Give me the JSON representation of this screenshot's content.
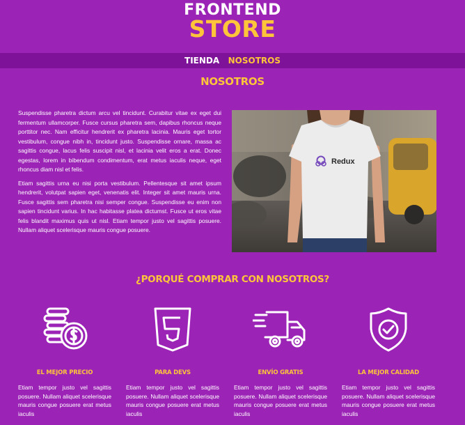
{
  "header": {
    "logo_top": "FRONTEND",
    "logo_bottom": "STORE"
  },
  "nav": {
    "items": [
      {
        "label": "TIENDA"
      },
      {
        "label": "NOSOTROS"
      }
    ]
  },
  "about": {
    "title": "NOSOTROS",
    "paragraphs": [
      "Suspendisse pharetra dictum arcu vel tincidunt. Curabitur vitae ex eget dui fermentum ullamcorper. Fusce cursus pharetra sem, dapibus rhoncus neque porttitor nec. Nam efficitur hendrerit ex pharetra lacinia. Mauris eget tortor vestibulum, congue nibh in, tincidunt justo. Suspendisse ornare, massa ac sagittis congue, lacus felis suscipit nisl, et lacinia velit eros a erat. Donec egestas, lorem in bibendum condimentum, erat metus iaculis neque, eget rhoncus diam nisl et felis.",
      "Etiam sagittis urna eu nisi porta vestibulum. Pellentesque sit amet ipsum hendrerit, volutpat sapien eget, venenatis elit. Integer sit amet mauris urna. Fusce sagittis sem pharetra nisi semper congue. Suspendisse eu enim non sapien tincidunt varius. In hac habitasse platea dictumst. Fusce ut eros vitae felis blandit maximus quis ut nisl. Etiam tempor justo vel sagittis posuere. Nullam aliquet scelerisque mauris congue posuere."
    ],
    "image_brand": "Redux"
  },
  "why": {
    "title": "¿PORQUÉ COMPRAR CON NOSOTROS?",
    "features": [
      {
        "icon": "coins-icon",
        "title": "EL MEJOR PRECIO",
        "text": "Etiam tempor justo vel sagittis posuere. Nullam aliquet scelerisque mauris congue posuere erat metus iaculis"
      },
      {
        "icon": "html5-icon",
        "title": "PARA DEVS",
        "text": "Etiam tempor justo vel sagittis posuere. Nullam aliquet scelerisque mauris congue posuere erat metus iaculis"
      },
      {
        "icon": "truck-icon",
        "title": "ENVÍO GRATIS",
        "text": "Etiam tempor justo vel sagittis posuere. Nullam aliquet scelerisque mauris congue posuere erat metus iaculis"
      },
      {
        "icon": "shield-check-icon",
        "title": "LA MEJOR CALIDAD",
        "text": "Etiam tempor justo vel sagittis posuere. Nullam aliquet scelerisque mauris congue posuere erat metus iaculis"
      }
    ]
  },
  "colors": {
    "background": "#9b23b5",
    "nav_background": "#7e1299",
    "accent": "#fec53a",
    "text": "#ffffff"
  }
}
